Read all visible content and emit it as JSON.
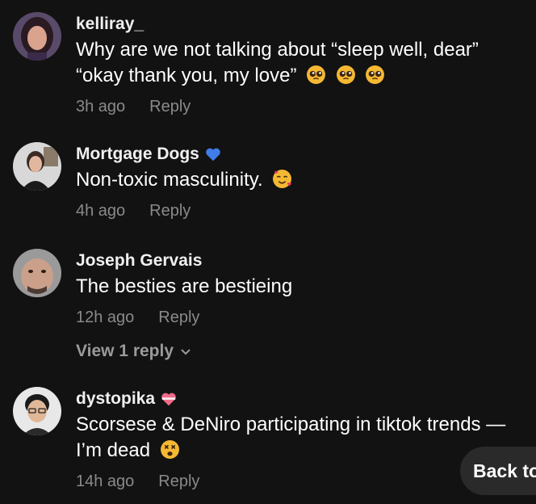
{
  "comments": [
    {
      "username": "kelliray_",
      "text": "Why are we not talking about “sleep well, dear” “okay thank you, my love”",
      "emojis": [
        "pleading-face-icon",
        "pleading-face-icon",
        "pleading-face-icon"
      ],
      "time": "3h ago",
      "reply_label": "Reply"
    },
    {
      "username": "Mortgage Dogs",
      "badge": "blue-heart-icon",
      "text": "Non-toxic masculinity.",
      "emojis": [
        "smiling-face-with-hearts-icon"
      ],
      "time": "4h ago",
      "reply_label": "Reply"
    },
    {
      "username": "Joseph Gervais",
      "text": "The besties are bestieing",
      "time": "12h ago",
      "reply_label": "Reply",
      "view_replies": "View 1 reply"
    },
    {
      "username": "dystopika",
      "badge": "heart-with-ribbon-icon",
      "text": "Scorsese & DeNiro participating in tiktok trends — I’m dead",
      "emojis": [
        "face-with-crossed-out-eyes-icon"
      ],
      "time": "14h ago",
      "reply_label": "Reply"
    }
  ],
  "back_button": {
    "label": "Back to top"
  },
  "colors": {
    "background": "#121212",
    "meta": "#8a8a8a",
    "button_bg": "#2a2a2a"
  }
}
